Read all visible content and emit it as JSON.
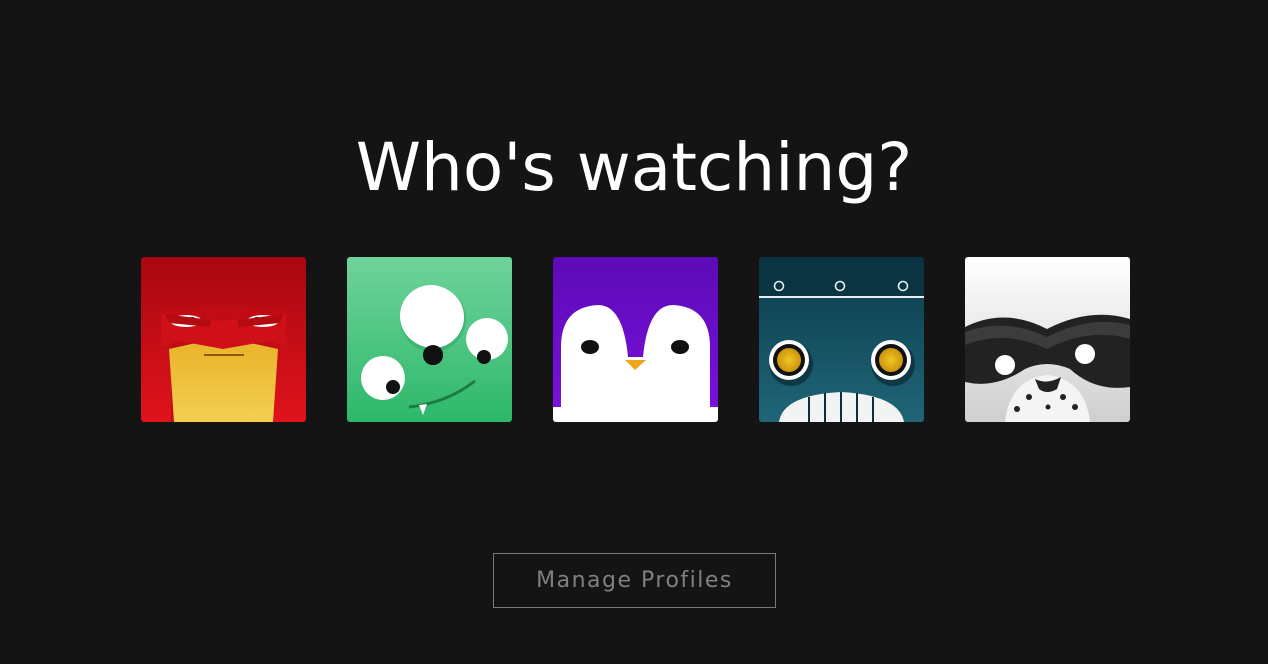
{
  "page": {
    "title": "Who's watching?"
  },
  "profiles": [
    {
      "icon": "red-angry-face-icon",
      "color": "#e50914"
    },
    {
      "icon": "green-three-eyed-monster-icon",
      "color": "#2fbf71"
    },
    {
      "icon": "purple-penguin-icon",
      "color": "#6a0dcc"
    },
    {
      "icon": "teal-robot-icon",
      "color": "#0f4c5c"
    },
    {
      "icon": "white-masked-raccoon-icon",
      "color": "#e6e6e6"
    }
  ],
  "actions": {
    "manage_profiles_label": "Manage Profiles"
  },
  "colors": {
    "background": "#141414",
    "title": "#ffffff",
    "button_border": "#7a7a7a",
    "button_text": "#808080"
  }
}
